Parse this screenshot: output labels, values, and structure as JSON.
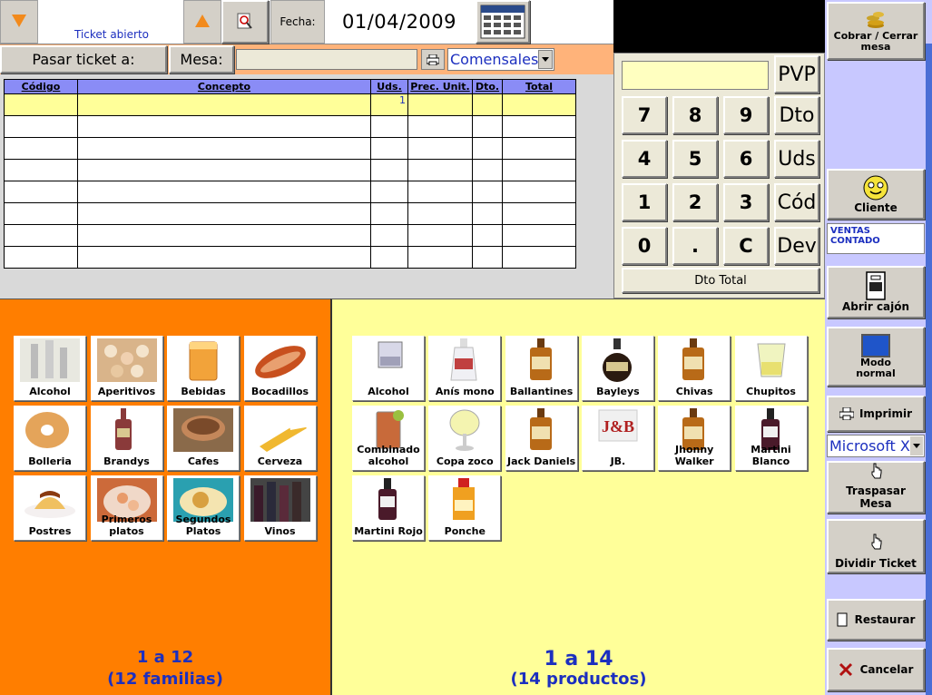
{
  "header": {
    "ticket_status": "Ticket abierto",
    "fecha_label": "Fecha:",
    "fecha_value": "01/04/2009"
  },
  "passbar": {
    "pasar_ticket_label": "Pasar ticket a:",
    "mesa_label": "Mesa:",
    "mesa_value": "",
    "comensales_value": "Comensales"
  },
  "ticket_table": {
    "columns": [
      "Código",
      "Concepto",
      "Uds.",
      "Prec. Unit.",
      "Dto.",
      "Total"
    ],
    "rows": [
      [
        "",
        "",
        "1",
        "",
        "",
        ""
      ],
      [
        "",
        "",
        "",
        "",
        "",
        ""
      ],
      [
        "",
        "",
        "",
        "",
        "",
        ""
      ],
      [
        "",
        "",
        "",
        "",
        "",
        ""
      ],
      [
        "",
        "",
        "",
        "",
        "",
        ""
      ],
      [
        "",
        "",
        "",
        "",
        "",
        ""
      ],
      [
        "",
        "",
        "",
        "",
        "",
        ""
      ],
      [
        "",
        "",
        "",
        "",
        "",
        ""
      ]
    ]
  },
  "keypad": {
    "display_value": "",
    "digits": [
      "7",
      "8",
      "9",
      "4",
      "5",
      "6",
      "1",
      "2",
      "3",
      "0",
      ".",
      "C"
    ],
    "side_keys": [
      "PVP",
      "Dto",
      "Uds",
      "Cód",
      "Dev"
    ],
    "dto_total_label": "Dto Total"
  },
  "families": {
    "items": [
      {
        "label": "Alcohol",
        "icon": "bottles-faded-icon"
      },
      {
        "label": "Aperitivos",
        "icon": "appetizers-icon"
      },
      {
        "label": "Bebidas",
        "icon": "drink-glass-icon"
      },
      {
        "label": "Bocadillos",
        "icon": "sandwich-icon"
      },
      {
        "label": "Bolleria",
        "icon": "donut-icon"
      },
      {
        "label": "Brandys",
        "icon": "brandy-bottle-icon"
      },
      {
        "label": "Cafes",
        "icon": "coffee-cup-icon"
      },
      {
        "label": "Cerveza",
        "icon": "beer-glass-icon"
      },
      {
        "label": "Postres",
        "icon": "flan-icon"
      },
      {
        "label": "Primeros platos",
        "icon": "first-course-icon"
      },
      {
        "label": "Segundos Platos",
        "icon": "second-course-icon"
      },
      {
        "label": "Vinos",
        "icon": "wine-bottles-icon"
      }
    ],
    "pager_range": "1 a 12",
    "pager_count": "(12 familias)"
  },
  "products": {
    "items": [
      {
        "label": "Alcohol",
        "icon": "glass-icon"
      },
      {
        "label": "Anís mono",
        "icon": "anis-bottle-icon"
      },
      {
        "label": "Ballantines",
        "icon": "whisky-bottle-icon"
      },
      {
        "label": "Bayleys",
        "icon": "liqueur-bottle-icon"
      },
      {
        "label": "Chivas",
        "icon": "whisky-bottle-icon"
      },
      {
        "label": "Chupitos",
        "icon": "shot-glass-icon"
      },
      {
        "label": "Combinado alcohol",
        "icon": "mixed-drink-icon"
      },
      {
        "label": "Copa zoco",
        "icon": "wine-glass-icon"
      },
      {
        "label": "Jack Daniels",
        "icon": "whisky-bottle-icon"
      },
      {
        "label": "JB.",
        "icon": "jb-logo-icon"
      },
      {
        "label": "Jhonny Walker",
        "icon": "whisky-bottle-icon"
      },
      {
        "label": "Martini Blanco",
        "icon": "vermouth-bottle-icon"
      },
      {
        "label": "Martini Rojo",
        "icon": "vermouth-bottle-icon"
      },
      {
        "label": "Ponche",
        "icon": "ponche-bottle-icon"
      }
    ],
    "pager_range": "1 a 14",
    "pager_count": "(14 productos)"
  },
  "sidebar": {
    "cobrar_label": "Cobrar / Cerrar mesa",
    "cliente_label": "Cliente",
    "ventas_label": "VENTAS CONTADO",
    "abrir_cajon_label": "Abrir cajón",
    "modo_normal_label": "Modo normal",
    "imprimir_label": "Imprimir",
    "font_select_value": "Microsoft X",
    "traspasar_label": "Traspasar Mesa",
    "dividir_label": "Dividir Ticket",
    "restaurar_label": "Restaurar",
    "cancelar_label": "Cancelar"
  },
  "colors": {
    "families_bg": "#ff7e00",
    "products_bg": "#ffff99",
    "header_blue": "#8a8cf6",
    "accent_blue": "#1c2fbf"
  }
}
